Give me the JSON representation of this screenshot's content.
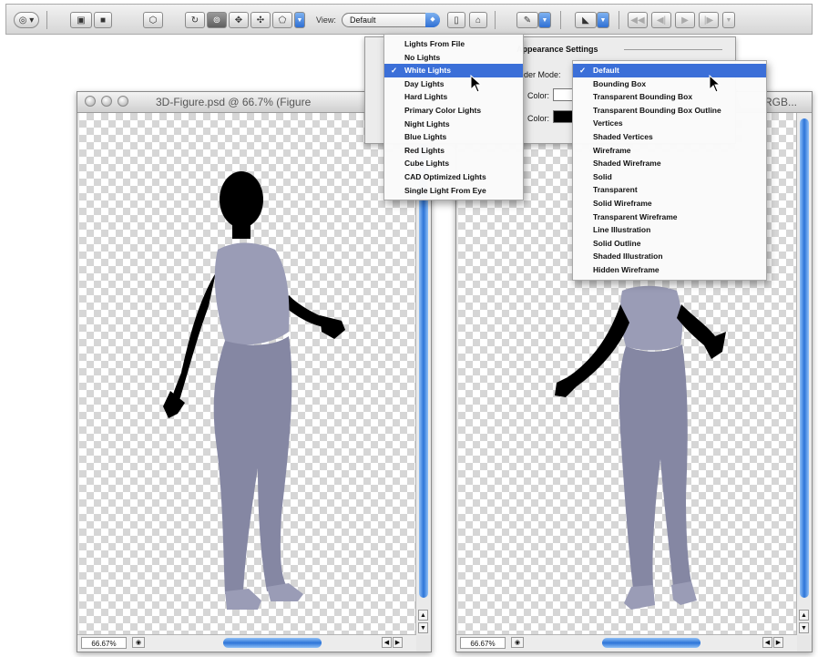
{
  "toolbar": {
    "view_label": "View:",
    "view_value": "Default"
  },
  "windows": {
    "left": {
      "title": "3D-Figure.psd @ 66.7% (Figure",
      "zoom": "66.67%"
    },
    "right": {
      "title": "RGB...",
      "zoom": "66.67%"
    }
  },
  "appearance_settings": {
    "title": "Appearance Settings",
    "render_mode_label": "der Mode:",
    "color_label_1": "Color:",
    "color_label_2": "Color:"
  },
  "lights_menu": {
    "items": [
      {
        "label": "Lights From File",
        "selected": false
      },
      {
        "label": "No Lights",
        "selected": false
      },
      {
        "label": "White Lights",
        "selected": true
      },
      {
        "label": "Day Lights",
        "selected": false
      },
      {
        "label": "Hard Lights",
        "selected": false
      },
      {
        "label": "Primary Color Lights",
        "selected": false
      },
      {
        "label": "Night Lights",
        "selected": false
      },
      {
        "label": "Blue Lights",
        "selected": false
      },
      {
        "label": "Red Lights",
        "selected": false
      },
      {
        "label": "Cube Lights",
        "selected": false
      },
      {
        "label": "CAD Optimized Lights",
        "selected": false
      },
      {
        "label": "Single Light From Eye",
        "selected": false
      }
    ]
  },
  "render_menu": {
    "items": [
      {
        "label": "Default",
        "selected": true
      },
      {
        "label": "Bounding Box",
        "selected": false
      },
      {
        "label": "Transparent Bounding Box",
        "selected": false
      },
      {
        "label": "Transparent Bounding Box Outline",
        "selected": false
      },
      {
        "label": "Vertices",
        "selected": false
      },
      {
        "label": "Shaded Vertices",
        "selected": false
      },
      {
        "label": "Wireframe",
        "selected": false
      },
      {
        "label": "Shaded Wireframe",
        "selected": false
      },
      {
        "label": "Solid",
        "selected": false
      },
      {
        "label": "Transparent",
        "selected": false
      },
      {
        "label": "Solid Wireframe",
        "selected": false
      },
      {
        "label": "Transparent Wireframe",
        "selected": false
      },
      {
        "label": "Line Illustration",
        "selected": false
      },
      {
        "label": "Solid Outline",
        "selected": false
      },
      {
        "label": "Shaded Illustration",
        "selected": false
      },
      {
        "label": "Hidden Wireframe",
        "selected": false
      }
    ]
  },
  "colors": {
    "accent": "#3b6fd8",
    "scroll_blue": "#2d74d8",
    "clothing": "#9a9cb6"
  },
  "icons": [
    "options-icon",
    "home-view-icon",
    "camera-icon",
    "3d-object-icon",
    "rotate-icon",
    "roll-icon",
    "drag-icon",
    "slide-icon",
    "scale-icon",
    "save-view-icon",
    "delete-view-icon",
    "lights-icon",
    "render-icon",
    "cross-section-icon",
    "playback-icons"
  ]
}
